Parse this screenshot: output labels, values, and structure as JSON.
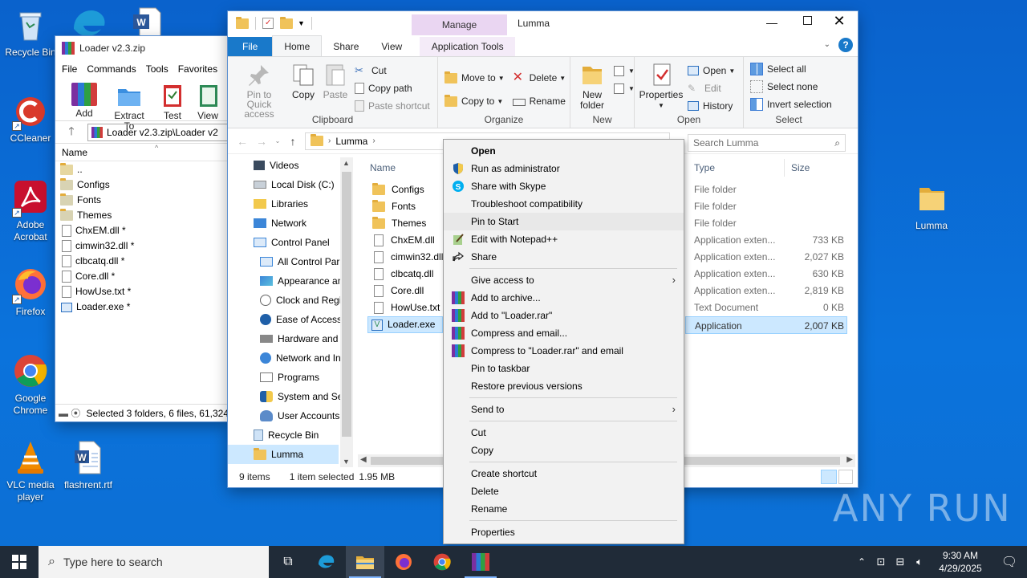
{
  "desktop_icons": [
    {
      "label": "Recycle Bin",
      "icon": "recycle-bin-icon"
    },
    {
      "label": "CCleaner",
      "icon": "ccleaner-icon"
    },
    {
      "label": "Adobe Acrobat",
      "icon": "acrobat-icon"
    },
    {
      "label": "Firefox",
      "icon": "firefox-icon"
    },
    {
      "label": "Google Chrome",
      "icon": "chrome-icon"
    },
    {
      "label": "VLC media player",
      "icon": "vlc-icon"
    },
    {
      "label": "flashrent.rtf",
      "icon": "word-doc-icon"
    },
    {
      "label": "Lumma",
      "icon": "folder-icon"
    }
  ],
  "winrar": {
    "title": "Loader v2.3.zip",
    "menu": [
      "File",
      "Commands",
      "Tools",
      "Favorites"
    ],
    "toolbar": [
      "Add",
      "Extract To",
      "Test",
      "View"
    ],
    "path": "Loader v2.3.zip\\Loader v2",
    "column_name": "Name",
    "files": [
      "..",
      "Configs",
      "Fonts",
      "Themes",
      "ChxEM.dll *",
      "cimwin32.dll *",
      "clbcatq.dll *",
      "Core.dll *",
      "HowUse.txt *",
      "Loader.exe *"
    ],
    "status": "Selected 3 folders, 6 files, 61,324"
  },
  "explorer": {
    "title": "Lumma",
    "manage_tab": "Manage",
    "tabs": [
      "File",
      "Home",
      "Share",
      "View",
      "Application Tools"
    ],
    "ribbon": {
      "clipboard": {
        "label": "Clipboard",
        "pin": "Pin to Quick access",
        "copy": "Copy",
        "paste": "Paste",
        "cut": "Cut",
        "copy_path": "Copy path",
        "paste_shortcut": "Paste shortcut"
      },
      "organize": {
        "label": "Organize",
        "move_to": "Move to",
        "copy_to": "Copy to",
        "delete": "Delete",
        "rename": "Rename"
      },
      "new": {
        "label": "New",
        "new_folder": "New folder"
      },
      "open": {
        "label": "Open",
        "properties": "Properties",
        "open": "Open",
        "edit": "Edit",
        "history": "History"
      },
      "select": {
        "label": "Select",
        "select_all": "Select all",
        "select_none": "Select none",
        "invert": "Invert selection"
      }
    },
    "address": "Lumma",
    "search_placeholder": "Search Lumma",
    "nav": [
      "Videos",
      "Local Disk (C:)",
      "Libraries",
      "Network",
      "Control Panel",
      "All Control Par",
      "Appearance an",
      "Clock and Regi",
      "Ease of Access",
      "Hardware and",
      "Network and In",
      "Programs",
      "System and Se",
      "User Accounts",
      "Recycle Bin",
      "Lumma"
    ],
    "columns": {
      "name": "Name",
      "type": "Type",
      "size": "Size"
    },
    "files": [
      {
        "name": "Configs",
        "type": "File folder",
        "size": ""
      },
      {
        "name": "Fonts",
        "type": "File folder",
        "size": ""
      },
      {
        "name": "Themes",
        "type": "File folder",
        "size": ""
      },
      {
        "name": "ChxEM.dll",
        "type": "Application exten...",
        "size": "733 KB"
      },
      {
        "name": "cimwin32.dll",
        "type": "Application exten...",
        "size": "2,027 KB"
      },
      {
        "name": "clbcatq.dll",
        "type": "Application exten...",
        "size": "630 KB"
      },
      {
        "name": "Core.dll",
        "type": "Application exten...",
        "size": "2,819 KB"
      },
      {
        "name": "HowUse.txt",
        "type": "Text Document",
        "size": "0 KB"
      },
      {
        "name": "Loader.exe",
        "type": "Application",
        "size": "2,007 KB"
      }
    ],
    "status_items": "9 items",
    "status_selected": "1 item selected",
    "status_size": "1.95 MB"
  },
  "context_menu": [
    {
      "label": "Open",
      "bold": true
    },
    {
      "label": "Run as administrator",
      "icon": "shield-icon"
    },
    {
      "label": "Share with Skype",
      "icon": "skype-icon"
    },
    {
      "label": "Troubleshoot compatibility"
    },
    {
      "label": "Pin to Start",
      "hl": true
    },
    {
      "label": "Edit with Notepad++",
      "icon": "notepadpp-icon"
    },
    {
      "label": "Share",
      "icon": "share-icon"
    },
    {
      "sep": true
    },
    {
      "label": "Give access to",
      "sub": true
    },
    {
      "label": "Add to archive...",
      "icon": "winrar-icon"
    },
    {
      "label": "Add to \"Loader.rar\"",
      "icon": "winrar-icon"
    },
    {
      "label": "Compress and email...",
      "icon": "winrar-icon"
    },
    {
      "label": "Compress to \"Loader.rar\" and email",
      "icon": "winrar-icon"
    },
    {
      "label": "Pin to taskbar"
    },
    {
      "label": "Restore previous versions"
    },
    {
      "sep": true
    },
    {
      "label": "Send to",
      "sub": true
    },
    {
      "sep": true
    },
    {
      "label": "Cut"
    },
    {
      "label": "Copy"
    },
    {
      "sep": true
    },
    {
      "label": "Create shortcut"
    },
    {
      "label": "Delete"
    },
    {
      "label": "Rename"
    },
    {
      "sep": true
    },
    {
      "label": "Properties"
    }
  ],
  "taskbar": {
    "search_placeholder": "Type here to search",
    "time": "9:30 AM",
    "date": "4/29/2025"
  },
  "watermark": "ANY RUN",
  "colors": {
    "accent": "#1979ca",
    "selection": "#cce8ff",
    "desktop": "#0b6fd6",
    "taskbar": "#202b38"
  }
}
